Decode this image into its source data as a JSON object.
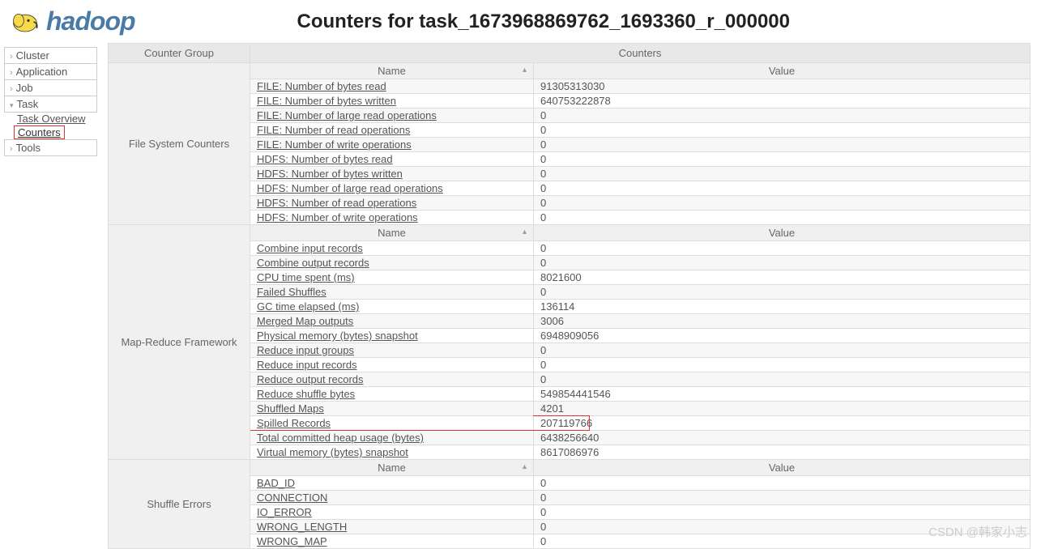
{
  "header": {
    "logo_text": "hadoop",
    "page_title": "Counters for task_1673968869762_1693360_r_000000"
  },
  "sidebar": {
    "items": [
      {
        "label": "Cluster",
        "expanded": false
      },
      {
        "label": "Application",
        "expanded": false
      },
      {
        "label": "Job",
        "expanded": false
      },
      {
        "label": "Task",
        "expanded": true,
        "children": [
          {
            "label": "Task Overview"
          },
          {
            "label": "Counters",
            "highlighted": true
          }
        ]
      },
      {
        "label": "Tools",
        "expanded": false
      }
    ]
  },
  "table": {
    "col_group": "Counter Group",
    "col_counters": "Counters",
    "col_name": "Name",
    "col_value": "Value",
    "groups": [
      {
        "name": "File System Counters",
        "rows": [
          {
            "name": "FILE: Number of bytes read",
            "value": "91305313030"
          },
          {
            "name": "FILE: Number of bytes written",
            "value": "640753222878"
          },
          {
            "name": "FILE: Number of large read operations",
            "value": "0"
          },
          {
            "name": "FILE: Number of read operations",
            "value": "0"
          },
          {
            "name": "FILE: Number of write operations",
            "value": "0"
          },
          {
            "name": "HDFS: Number of bytes read",
            "value": "0"
          },
          {
            "name": "HDFS: Number of bytes written",
            "value": "0"
          },
          {
            "name": "HDFS: Number of large read operations",
            "value": "0"
          },
          {
            "name": "HDFS: Number of read operations",
            "value": "0"
          },
          {
            "name": "HDFS: Number of write operations",
            "value": "0"
          }
        ]
      },
      {
        "name": "Map-Reduce Framework",
        "rows": [
          {
            "name": "Combine input records",
            "value": "0"
          },
          {
            "name": "Combine output records",
            "value": "0"
          },
          {
            "name": "CPU time spent (ms)",
            "value": "8021600"
          },
          {
            "name": "Failed Shuffles",
            "value": "0"
          },
          {
            "name": "GC time elapsed (ms)",
            "value": "136114"
          },
          {
            "name": "Merged Map outputs",
            "value": "3006"
          },
          {
            "name": "Physical memory (bytes) snapshot",
            "value": "6948909056"
          },
          {
            "name": "Reduce input groups",
            "value": "0"
          },
          {
            "name": "Reduce input records",
            "value": "0"
          },
          {
            "name": "Reduce output records",
            "value": "0"
          },
          {
            "name": "Reduce shuffle bytes",
            "value": "549854441546"
          },
          {
            "name": "Shuffled Maps",
            "value": "4201"
          },
          {
            "name": "Spilled Records",
            "value": "207119766",
            "highlighted": true
          },
          {
            "name": "Total committed heap usage (bytes)",
            "value": "6438256640"
          },
          {
            "name": "Virtual memory (bytes) snapshot",
            "value": "8617086976"
          }
        ]
      },
      {
        "name": "Shuffle Errors",
        "rows": [
          {
            "name": "BAD_ID",
            "value": "0"
          },
          {
            "name": "CONNECTION",
            "value": "0"
          },
          {
            "name": "IO_ERROR",
            "value": "0"
          },
          {
            "name": "WRONG_LENGTH",
            "value": "0"
          },
          {
            "name": "WRONG_MAP",
            "value": "0"
          }
        ]
      }
    ]
  },
  "watermark": "CSDN @韩家小志"
}
